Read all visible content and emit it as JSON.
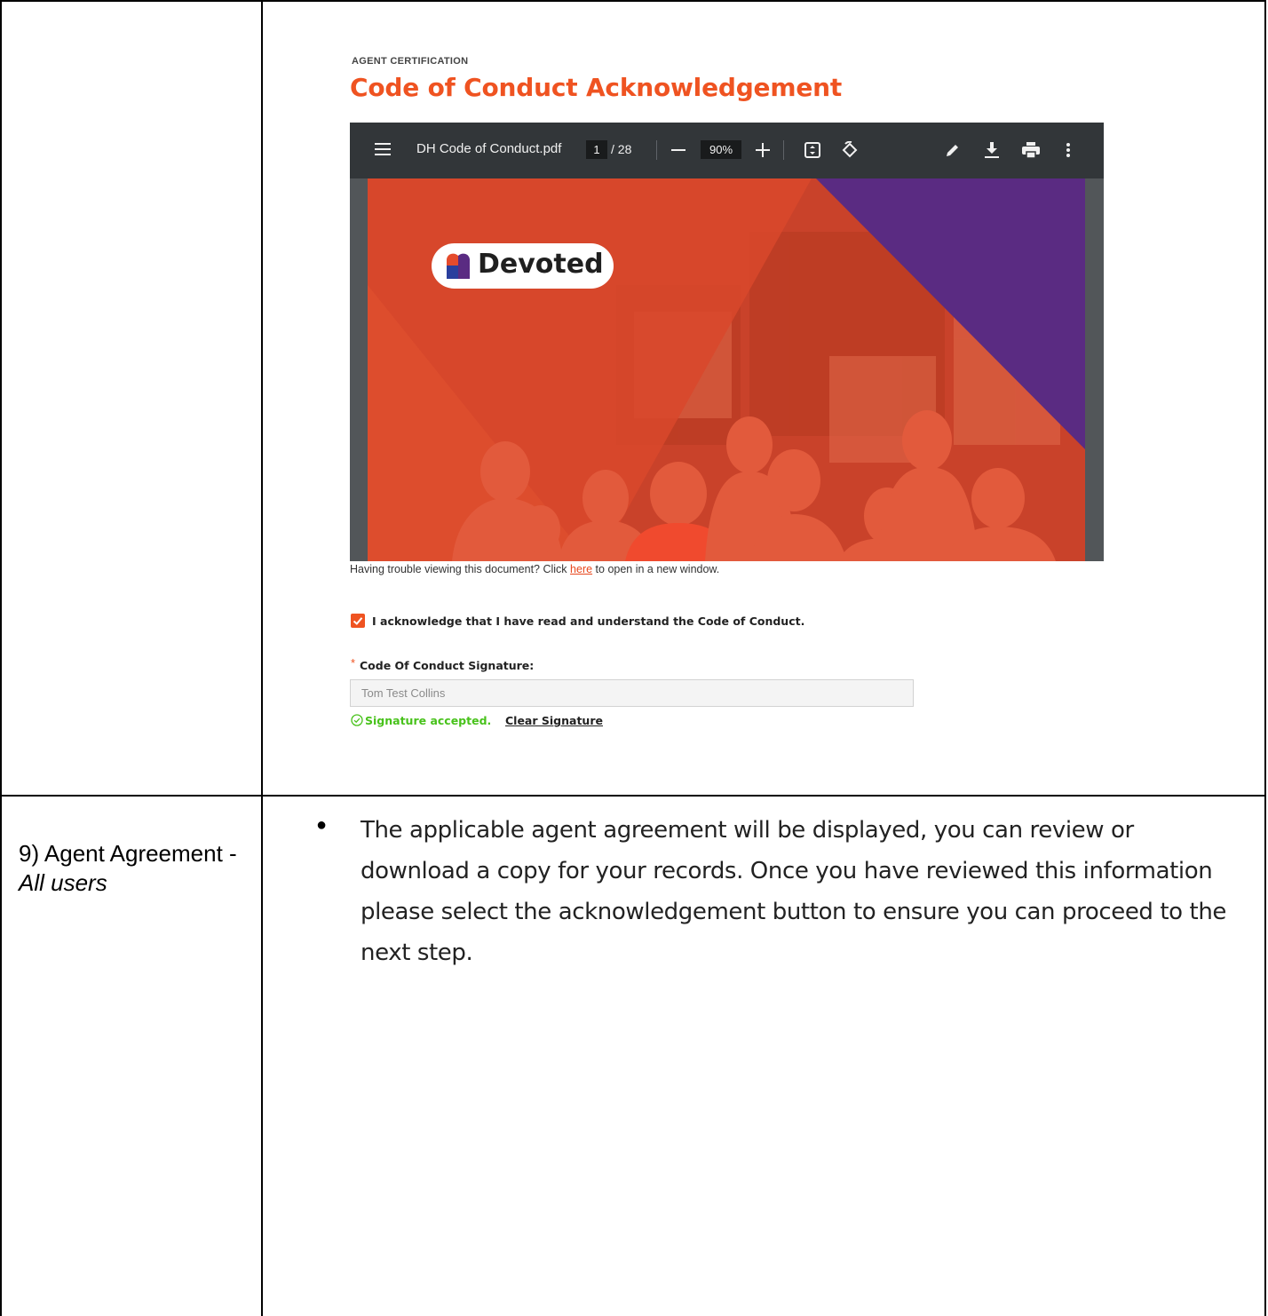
{
  "screenshot": {
    "eyebrow": "AGENT CERTIFICATION",
    "title": "Code of Conduct Acknowledgement",
    "pdf_viewer": {
      "file_name": "DH Code of Conduct.pdf",
      "current_page": "1",
      "page_total": "/ 28",
      "zoom": "90%",
      "icons": [
        "menu-icon",
        "zoom-out-icon",
        "zoom-in-icon",
        "fit-page-icon",
        "rotate-icon",
        "pen-icon",
        "download-icon",
        "print-icon",
        "more-icon"
      ]
    },
    "cover": {
      "brand": "Devoted",
      "colors": {
        "orange": "#d8452a",
        "purple": "#5a2b82",
        "logo_blue": "#2a3f9d",
        "logo_red": "#e54b2c"
      }
    },
    "help": {
      "before": "Having trouble viewing this document? Click ",
      "link": "here",
      "after": " to open in a new window."
    },
    "acknowledge": {
      "checked": true,
      "label": "I acknowledge that I have read and understand the Code of Conduct."
    },
    "signature": {
      "required_mark": "*",
      "label": "Code Of Conduct Signature:",
      "value": "Tom Test Collins",
      "status": "Signature accepted.",
      "clear_label": "Clear Signature"
    },
    "accent_color": "#ef5321",
    "success_color": "#48c21b"
  },
  "row2": {
    "step_prefix": "9) Agent Agreement - ",
    "step_italic": "All users",
    "bullet": "●",
    "description": "The applicable agent agreement will be displayed, you can review or download a copy for your records. Once you have reviewed this information please select the acknowledgement button to ensure you can proceed to the next step."
  }
}
